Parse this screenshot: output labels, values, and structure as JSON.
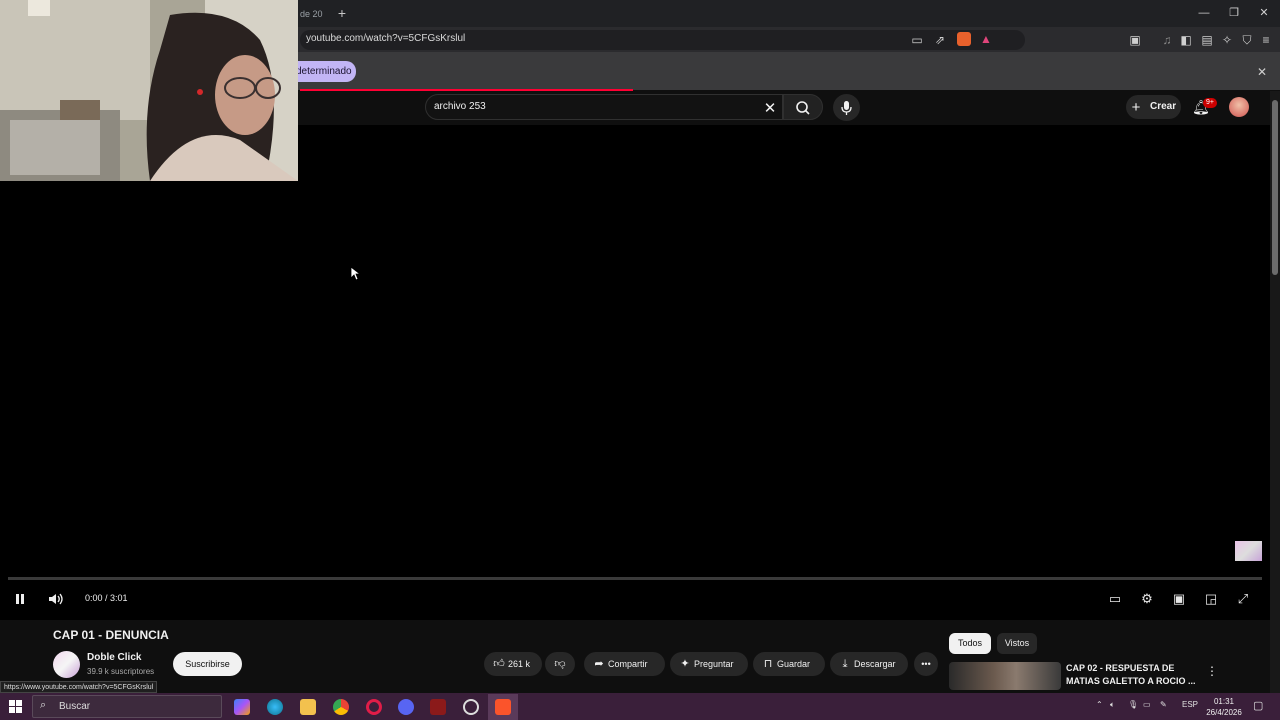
{
  "browser": {
    "tab_title": "de 20",
    "new_tab": "+",
    "url": "youtube.com/watch?v=5CFGsKrslul",
    "info_pill": "determinado",
    "close_info": "✕",
    "window_controls": {
      "minimize": "—",
      "restore": "❐",
      "close": "✕"
    }
  },
  "youtube": {
    "search_query": "archivo 253",
    "create_label": "Crear",
    "notifications_badge": "9+",
    "player": {
      "time": "0:00 / 3:01"
    },
    "video": {
      "title": "CAP 01 - DENUNCIA",
      "channel_name": "Doble Click",
      "subscribers": "39.9 k suscriptores",
      "subscribe_label": "Suscribirse",
      "like_count": "261 k",
      "share_label": "Compartir",
      "ask_label": "Preguntar",
      "save_label": "Guardar",
      "download_label": "Descargar"
    },
    "chips": {
      "all": "Todos",
      "watched": "Vistos"
    },
    "recommendation": {
      "title": "CAP 02 - RESPUESTA DE MATIAS GALETTO A ROCIO ..."
    }
  },
  "status_url": "https://www.youtube.com/watch?v=5CFGsKrslul",
  "taskbar": {
    "search_placeholder": "Buscar",
    "language": "ESP",
    "time": "01:31",
    "date": "26/4/2026"
  },
  "colors": {
    "yt_background": "#0f0f0f",
    "progress_red": "#ff0033",
    "taskbar": "#3a1f3a",
    "info_pill": "#c2b5f5"
  },
  "icons": [
    "search-icon",
    "mic-icon",
    "bell-icon",
    "clear-icon",
    "pause-icon",
    "volume-icon",
    "captions-icon",
    "settings-icon",
    "theater-icon",
    "cast-icon",
    "fullscreen-icon",
    "like-icon",
    "dislike-icon",
    "share-icon",
    "sparkle-icon",
    "bookmark-icon",
    "download-icon",
    "more-icon",
    "windows-start-icon"
  ]
}
